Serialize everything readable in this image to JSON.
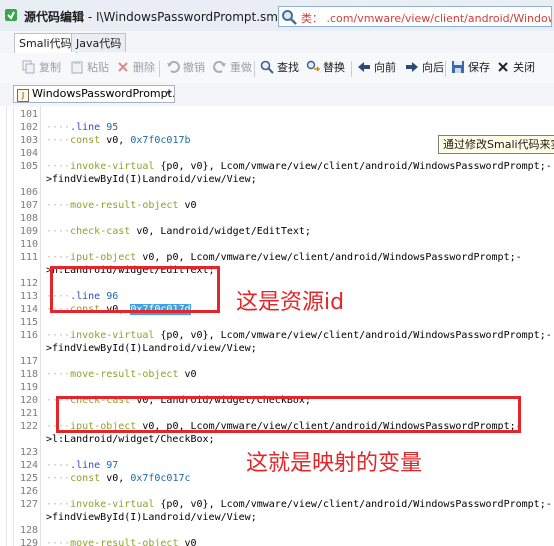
{
  "window": {
    "title_bold": "源代码编辑",
    "title_rest": " - I\\WindowsPasswordPrompt.smali",
    "search_text": "类：  .com/vmware/view/client/android/WindowsPassword"
  },
  "tabs": [
    {
      "label": "Smali代码"
    },
    {
      "label": "Java代码"
    }
  ],
  "toolbar": {
    "copy": "复制",
    "paste": "粘贴",
    "delete": "删除",
    "undo": "撤销",
    "redo": "重做",
    "find": "查找",
    "replace": "替换",
    "back": "向前",
    "forward": "向后",
    "save": "保存",
    "close": "关闭"
  },
  "file_selector": {
    "value": "WindowsPasswordPrompt.s"
  },
  "tooltip": "通过修改Smali代码来实现",
  "code_lines": [
    {
      "n": "101",
      "t": ""
    },
    {
      "n": "102",
      "t": "    .line 95"
    },
    {
      "n": "103",
      "t": "    const v0, 0x7f0c017b"
    },
    {
      "n": "104",
      "t": ""
    },
    {
      "n": "105",
      "t": "    invoke-virtual {p0, v0}, Lcom/vmware/view/client/android/WindowsPasswordPrompt;-"
    },
    {
      "n": "",
      "t": ">findViewById(I)Landroid/view/View;"
    },
    {
      "n": "106",
      "t": ""
    },
    {
      "n": "107",
      "t": "    move-result-object v0"
    },
    {
      "n": "108",
      "t": ""
    },
    {
      "n": "109",
      "t": "    check-cast v0, Landroid/widget/EditText;"
    },
    {
      "n": "110",
      "t": ""
    },
    {
      "n": "111",
      "t": "    iput-object v0, p0, Lcom/vmware/view/client/android/WindowsPasswordPrompt;-"
    },
    {
      "n": "",
      "t": ">n:Landroid/widget/EditText;"
    },
    {
      "n": "112",
      "t": ""
    },
    {
      "n": "113",
      "t": "    .line 96"
    },
    {
      "n": "114",
      "t": "    const v0, 0x7f0c017d"
    },
    {
      "n": "115",
      "t": ""
    },
    {
      "n": "116",
      "t": "    invoke-virtual {p0, v0}, Lcom/vmware/view/client/android/WindowsPasswordPrompt;-"
    },
    {
      "n": "",
      "t": ">findViewById(I)Landroid/view/View;"
    },
    {
      "n": "117",
      "t": ""
    },
    {
      "n": "118",
      "t": "    move-result-object v0"
    },
    {
      "n": "119",
      "t": ""
    },
    {
      "n": "120",
      "t": "    check-cast v0, Landroid/widget/CheckBox;"
    },
    {
      "n": "121",
      "t": ""
    },
    {
      "n": "122",
      "t": "    iput-object v0, p0, Lcom/vmware/view/client/android/WindowsPasswordPrompt;-"
    },
    {
      "n": "",
      "t": ">l:Landroid/widget/CheckBox;"
    },
    {
      "n": "123",
      "t": ""
    },
    {
      "n": "124",
      "t": "    .line 97"
    },
    {
      "n": "125",
      "t": "    const v0, 0x7f0c017c"
    },
    {
      "n": "126",
      "t": ""
    },
    {
      "n": "127",
      "t": "    invoke-virtual {p0, v0}, Lcom/vmware/view/client/android/WindowsPasswordPrompt;-"
    },
    {
      "n": "",
      "t": ">findViewById(I)Landroid/view/View;"
    },
    {
      "n": "128",
      "t": ""
    },
    {
      "n": "129",
      "t": "    move-result-object v0"
    },
    {
      "n": "130",
      "t": ""
    }
  ],
  "highlighted_value": "0x7f0c017d",
  "annotations": {
    "resource_id": "这是资源id",
    "mapped_variable": "这就是映射的变量"
  },
  "colors": {
    "annotation_red": "#e3262a",
    "selection_blue": "#3ba2e6",
    "directive_blue": "#2c4fbf",
    "instruction_green": "#8fa12a"
  }
}
